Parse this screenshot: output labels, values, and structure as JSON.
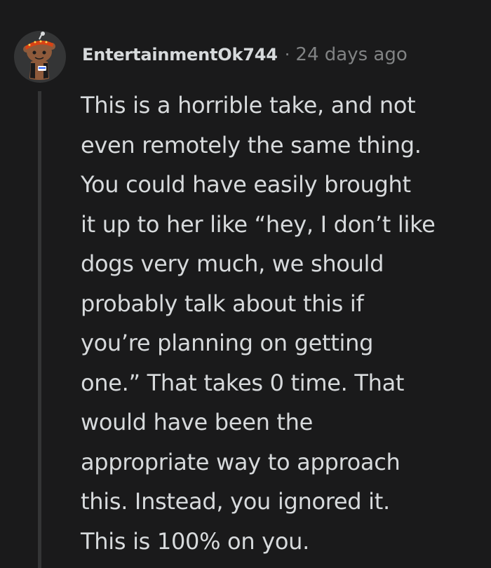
{
  "comment": {
    "author": "EntertainmentOk744",
    "separator": "·",
    "timestamp": "24 days ago",
    "body_lines": [
      "This is a horrible take, and not",
      "even remotely the same thing.",
      "You could have easily brought",
      "it up to her like “hey, I don’t like",
      "dogs very much, we should",
      "probably talk about this if",
      "you’re planning on getting",
      "one.” That takes 0 time. That",
      "would have been the",
      "appropriate way to approach",
      "this. Instead, you ignored it.",
      "This is 100% on you."
    ]
  },
  "colors": {
    "background": "#1a1a1b",
    "text": "#d7dadc",
    "meta": "#818384",
    "thread_line": "#343536",
    "avatar_bg": "#343536",
    "avatar_headband": "#d84315",
    "avatar_face": "#8d5a3b"
  },
  "icons": {
    "avatar": "snoo-avatar-icon"
  }
}
